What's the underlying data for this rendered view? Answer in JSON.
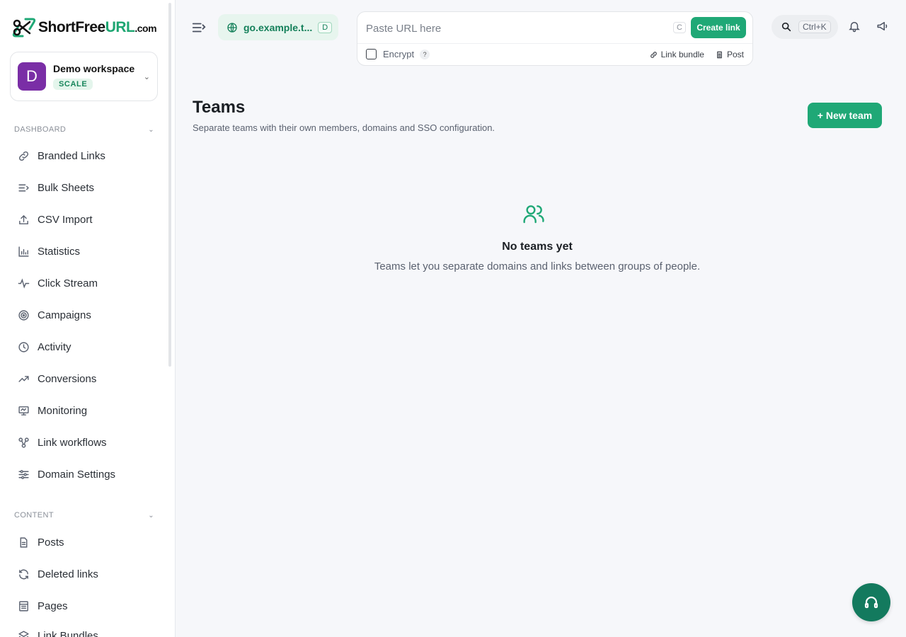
{
  "brand": {
    "name_part1": "ShortFree",
    "name_part2": "URL",
    "name_part3": ".com",
    "accent_color": "#1fa876"
  },
  "workspace": {
    "initial": "D",
    "name": "Demo workspace",
    "plan": "SCALE"
  },
  "sidebar": {
    "dashboard_label": "DASHBOARD",
    "dashboard_items": [
      {
        "label": "Branded Links",
        "icon": "link-icon"
      },
      {
        "label": "Bulk Sheets",
        "icon": "list-icon"
      },
      {
        "label": "CSV Import",
        "icon": "upload-icon"
      },
      {
        "label": "Statistics",
        "icon": "bar-chart-icon"
      },
      {
        "label": "Click Stream",
        "icon": "activity-icon"
      },
      {
        "label": "Campaigns",
        "icon": "target-icon"
      },
      {
        "label": "Activity",
        "icon": "clock-icon"
      },
      {
        "label": "Conversions",
        "icon": "trending-up-icon"
      },
      {
        "label": "Monitoring",
        "icon": "monitor-icon"
      },
      {
        "label": "Link workflows",
        "icon": "workflow-icon"
      },
      {
        "label": "Domain Settings",
        "icon": "sliders-icon"
      }
    ],
    "content_label": "CONTENT",
    "content_items": [
      {
        "label": "Posts",
        "icon": "file-icon"
      },
      {
        "label": "Deleted links",
        "icon": "refresh-icon"
      },
      {
        "label": "Pages",
        "icon": "page-icon"
      },
      {
        "label": "Link Bundles",
        "icon": "layers-icon"
      }
    ]
  },
  "topbar": {
    "domain": "go.example.t...",
    "domain_key": "D",
    "url_placeholder": "Paste URL here",
    "create_key": "C",
    "create_label": "Create link",
    "encrypt_label": "Encrypt",
    "help_label": "?",
    "link_bundle_label": "Link bundle",
    "post_label": "Post",
    "search_shortcut": "Ctrl+K"
  },
  "main": {
    "title": "Teams",
    "subtitle": "Separate teams with their own members, domains and SSO configuration.",
    "new_team_label": "+ New team",
    "empty_title": "No teams yet",
    "empty_subtitle": "Teams let you separate domains and links between groups of people."
  }
}
